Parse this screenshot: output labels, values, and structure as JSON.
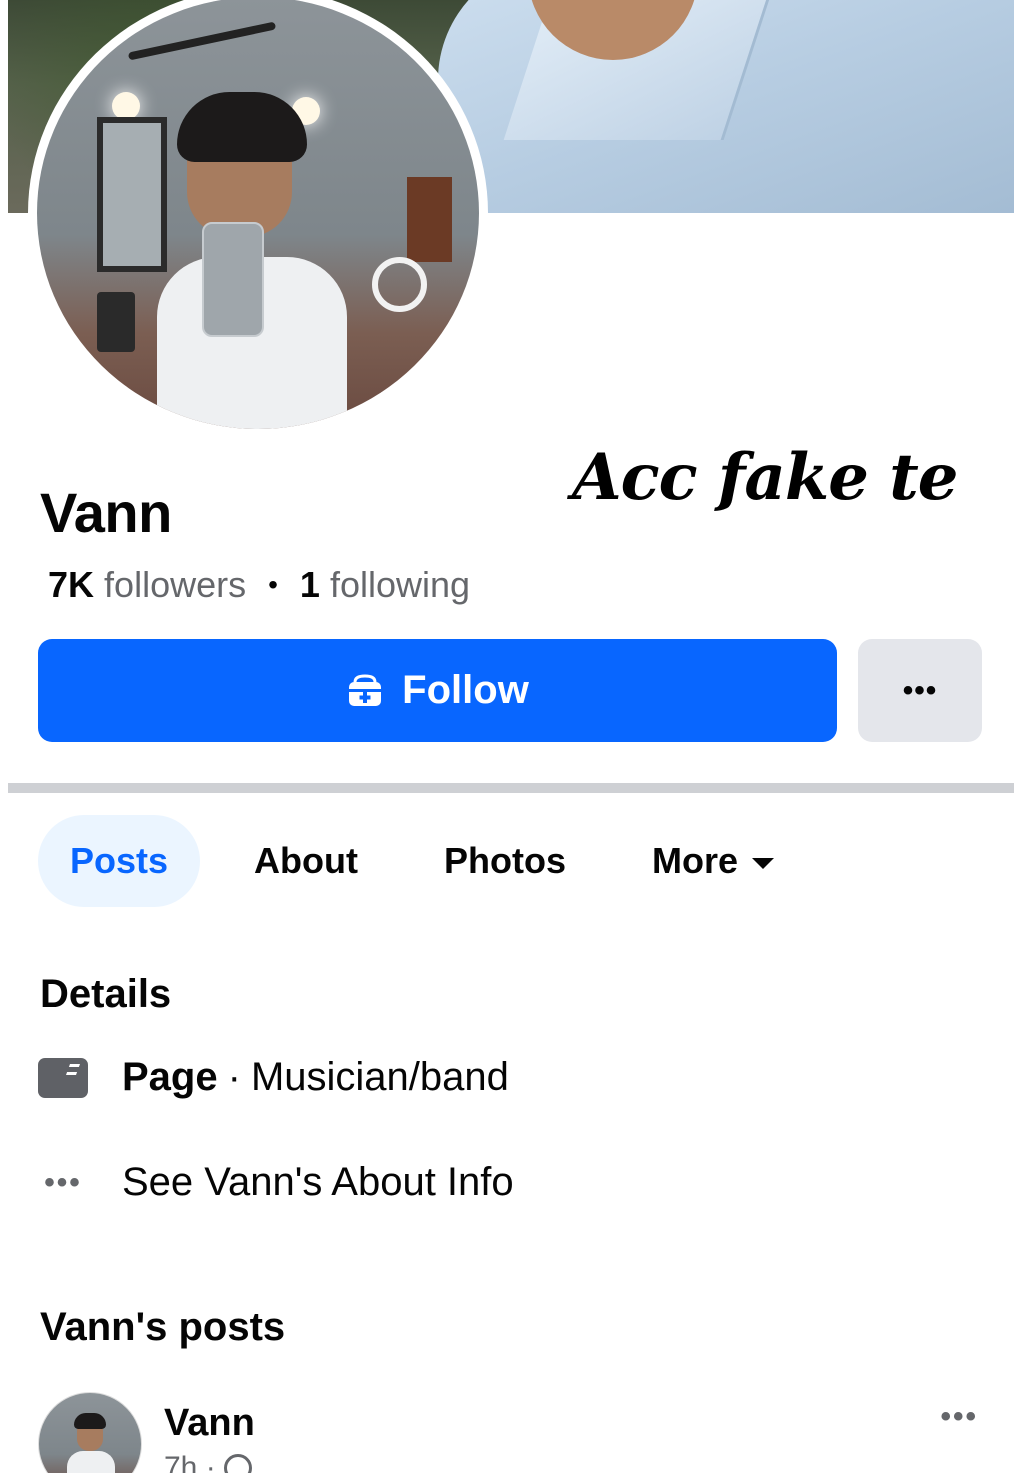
{
  "overlay": {
    "caption": "Acc fake te"
  },
  "profile": {
    "name": "Vann",
    "followers_count": "7K",
    "followers_label": "followers",
    "following_count": "1",
    "following_label": "following"
  },
  "actions": {
    "follow_label": "Follow",
    "more_label": "•••"
  },
  "tabs": [
    {
      "label": "Posts",
      "active": true
    },
    {
      "label": "About",
      "active": false
    },
    {
      "label": "Photos",
      "active": false
    },
    {
      "label": "More",
      "active": false
    }
  ],
  "details": {
    "title": "Details",
    "page_label": "Page",
    "page_separator": "·",
    "page_category": "Musician/band",
    "about_link": "See Vann's About Info",
    "dots": "•••"
  },
  "posts": {
    "title": "Vann's posts",
    "first": {
      "author": "Vann",
      "time": "7h ·",
      "more": "•••"
    }
  },
  "colors": {
    "primary": "#0866ff",
    "secondary_button": "#e4e6eb",
    "active_tab_bg": "#ebf5ff",
    "muted_text": "#65676b"
  }
}
